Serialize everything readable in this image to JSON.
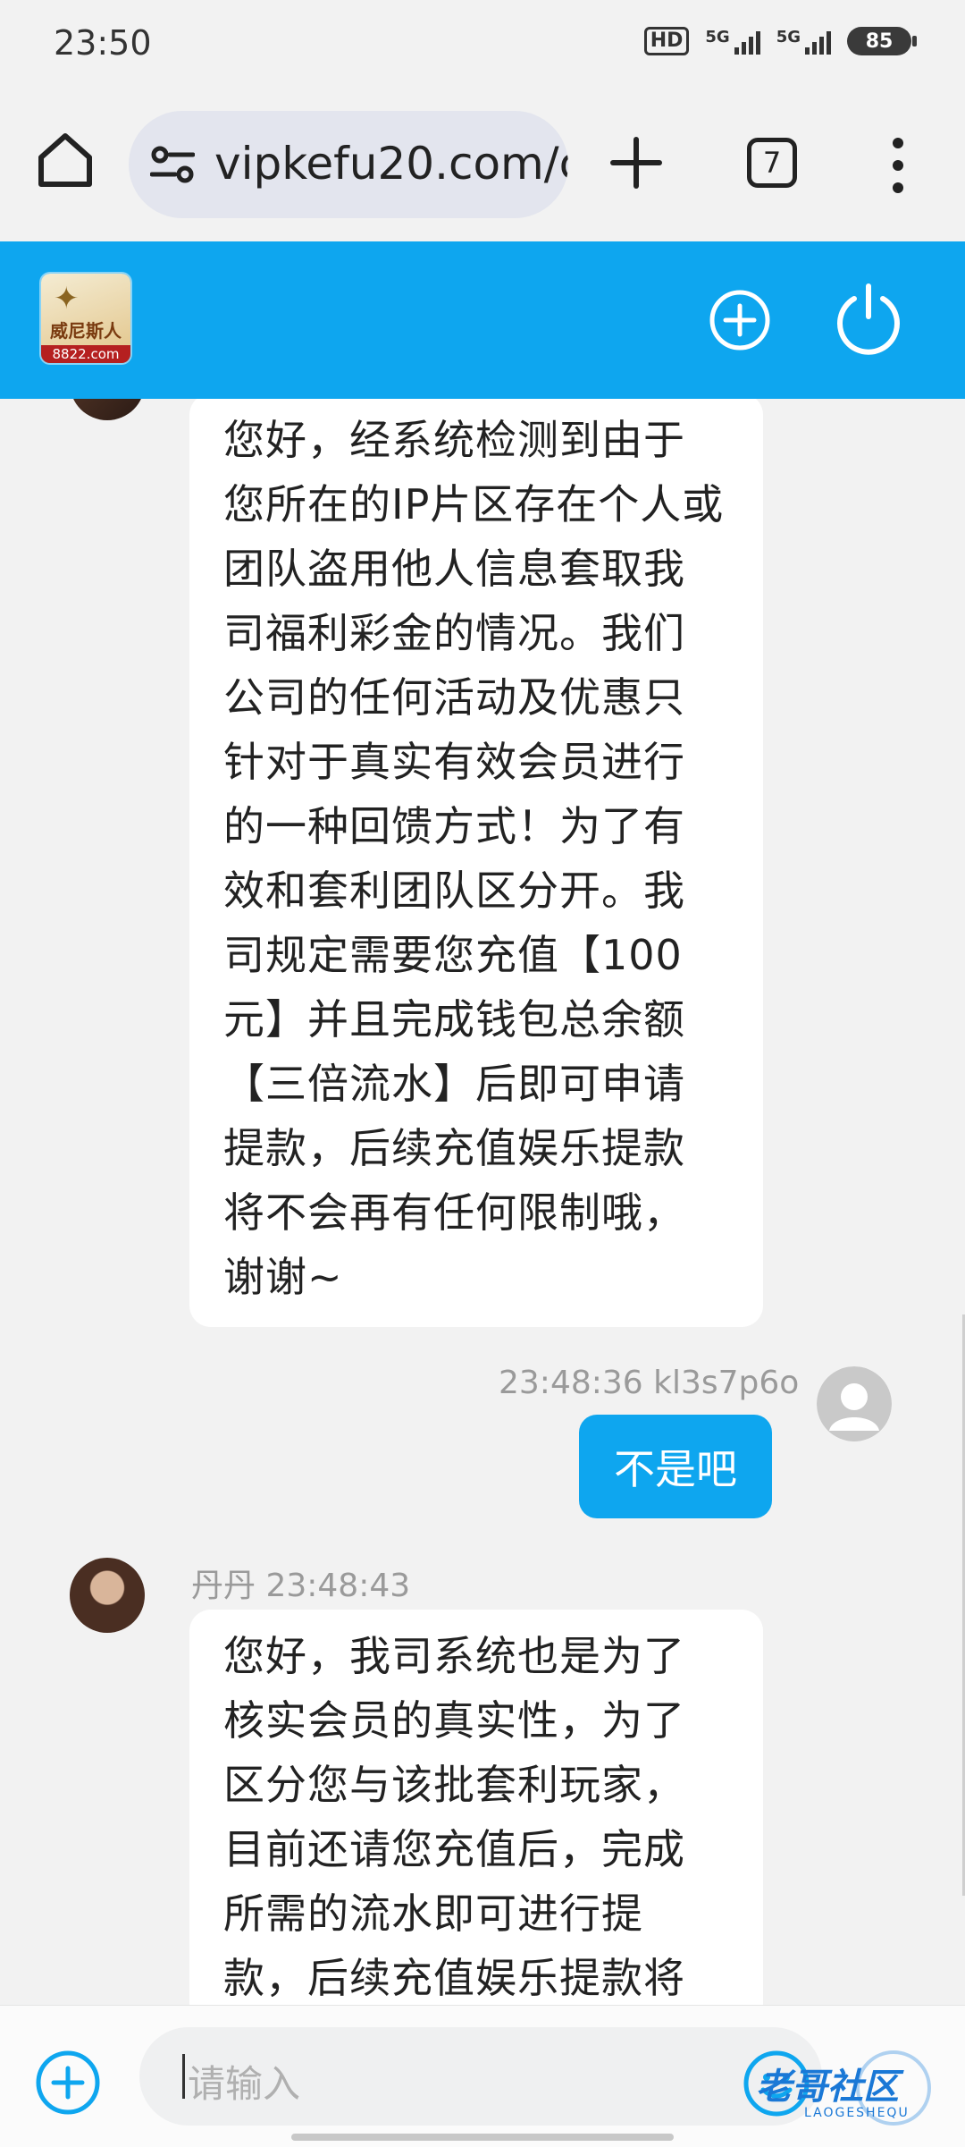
{
  "status_bar": {
    "time": "23:50",
    "hd_label": "HD",
    "signal1": "5G",
    "signal2": "5G",
    "battery": "85"
  },
  "browser": {
    "url": "vipkefu20.com/c",
    "tab_count": "7"
  },
  "header": {
    "logo_text": "威尼斯人",
    "logo_url": "8822.com",
    "accent_color": "#0ea6ef"
  },
  "chat": {
    "messages": [
      {
        "direction": "incoming",
        "lines": [
          "您好，经系统检测到由于",
          "您所在的IP片区存在个人或",
          "团队盗用他人信息套取我",
          "司福利彩金的情况。我们",
          "公司的任何活动及优惠只",
          "针对于真实有效会员进行",
          "的一种回馈方式！为了有",
          "效和套利团队区分开。我",
          "司规定需要您充值【100",
          "元】并且完成钱包总余额",
          "【三倍流水】后即可申请",
          "提款，后续充值娱乐提款",
          "将不会再有任何限制哦，",
          "谢谢~"
        ]
      },
      {
        "direction": "outgoing",
        "meta": "23:48:36 kl3s7p6o",
        "text": "不是吧"
      },
      {
        "direction": "incoming",
        "meta": "丹丹 23:48:43",
        "lines": [
          "您好，我司系统也是为了",
          "核实会员的真实性，为了",
          "区分您与该批套利玩家，",
          "目前还请您充值后，完成",
          "所需的流水即可进行提",
          "款，后续充值娱乐提款将"
        ]
      }
    ]
  },
  "input": {
    "placeholder": "请输入"
  },
  "watermark": {
    "text": "老哥社区",
    "sub": "LAOGESHEQU"
  }
}
